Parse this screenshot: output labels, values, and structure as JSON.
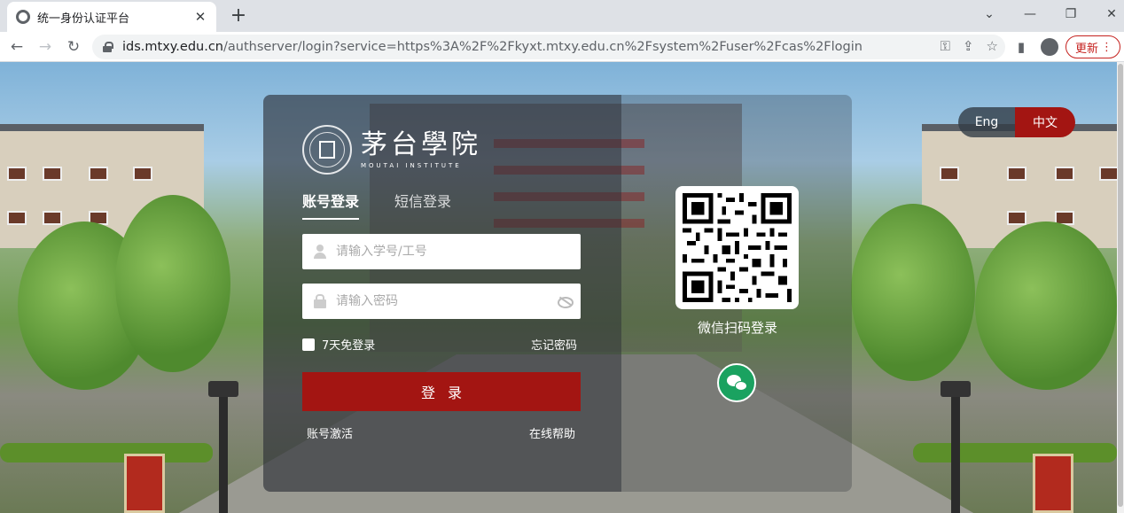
{
  "browser": {
    "tab_title": "统一身份认证平台",
    "url_host": "ids.mtxy.edu.cn",
    "url_path": "/authserver/login?service=https%3A%2F%2Fkyxt.mtxy.edu.cn%2Fsystem%2Fuser%2Fcas%2Flogin",
    "update_label": "更新"
  },
  "logo": {
    "name_cn": "茅台學院",
    "name_en": "MOUTAI INSTITUTE"
  },
  "login": {
    "tabs": [
      {
        "label": "账号登录",
        "active": true
      },
      {
        "label": "短信登录",
        "active": false
      }
    ],
    "username_placeholder": "请输入学号/工号",
    "password_placeholder": "请输入密码",
    "remember_label": "7天免登录",
    "forgot_label": "忘记密码",
    "submit_label": "登录",
    "activate_label": "账号激活",
    "help_label": "在线帮助"
  },
  "qr": {
    "label": "微信扫码登录"
  },
  "language": {
    "eng": "Eng",
    "cn": "中文",
    "selected": "中文"
  },
  "colors": {
    "accent": "#a31512",
    "wechat": "#1aa260"
  }
}
